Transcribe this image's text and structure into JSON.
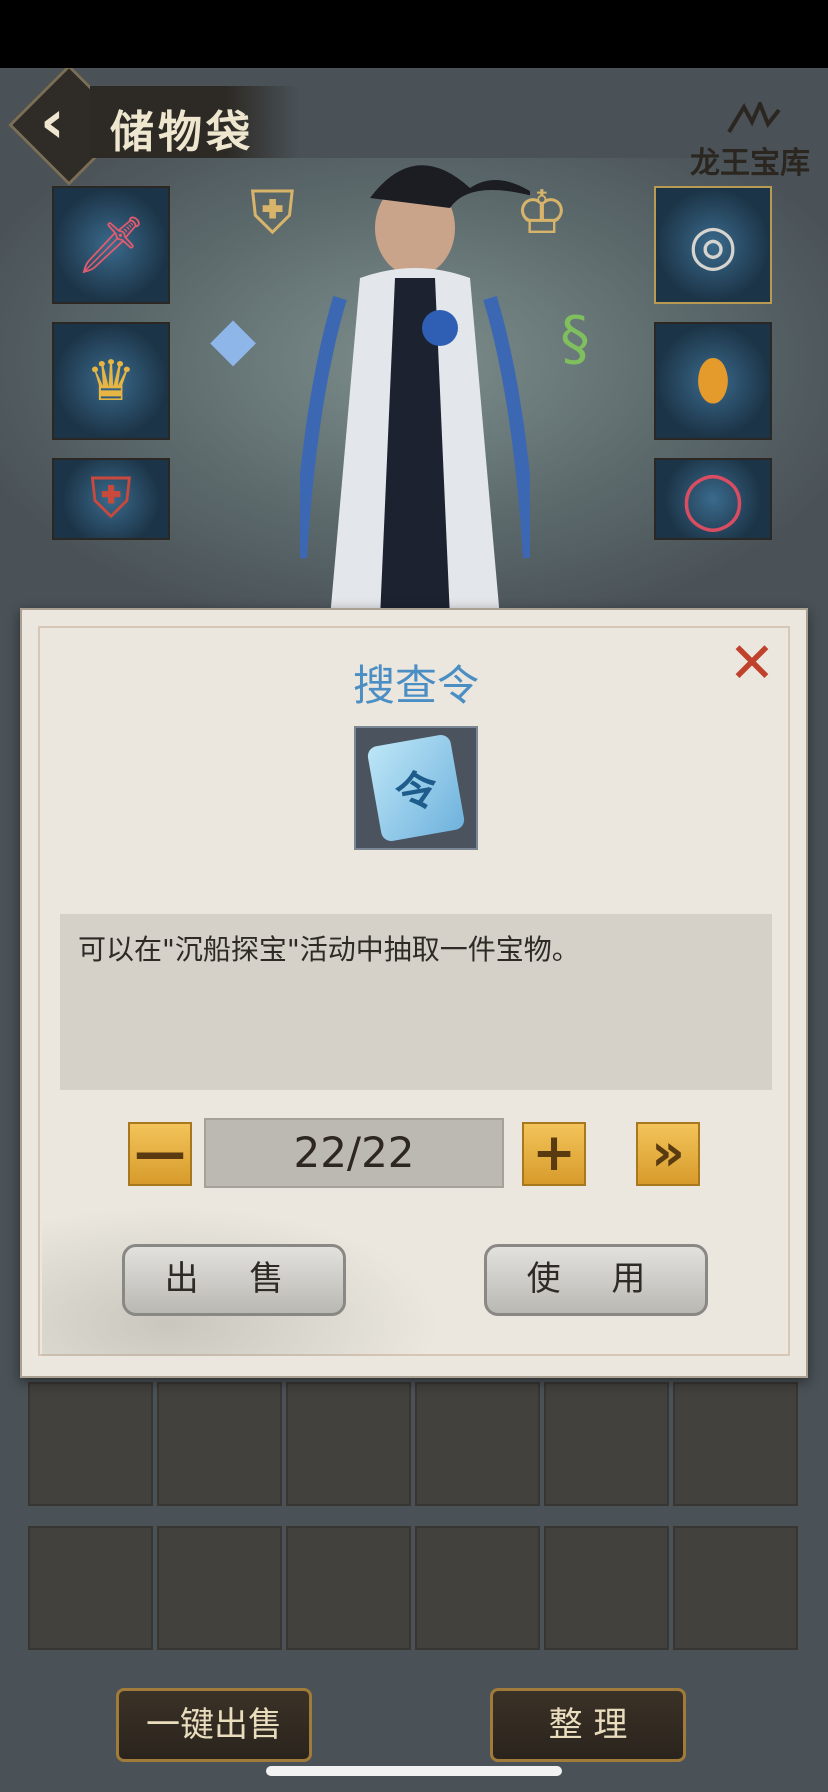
{
  "header": {
    "title": "储物袋",
    "brand": "龙王宝库"
  },
  "modal": {
    "title": "搜查令",
    "item_glyph": "令",
    "description": "可以在\"沉船探宝\"活动中抽取一件宝物。",
    "quantity": "22/22",
    "minus_label": "—",
    "plus_label": "+",
    "max_label": "»",
    "sell_label": "出 售",
    "use_label": "使 用",
    "close_label": "✕"
  },
  "footer": {
    "quick_sell_label": "一键出售",
    "organize_label": "整 理"
  },
  "colors": {
    "accent_blue": "#4b8ec4",
    "close_red": "#c0412c",
    "gold": "#d79b2b"
  }
}
